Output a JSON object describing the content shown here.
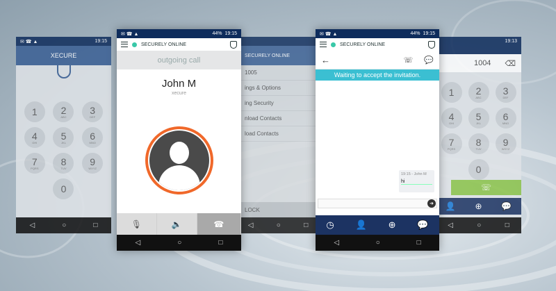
{
  "colors": {
    "navy": "#0e2c5c",
    "orange": "#f0682a",
    "teal": "#3bbfd2",
    "green": "#39c8a8"
  },
  "status": {
    "time_left": "19:15",
    "time_right": "19:13",
    "battery": "44%"
  },
  "phone_a": {
    "title": "XECURE",
    "keys": [
      {
        "d": "1",
        "l": ""
      },
      {
        "d": "2",
        "l": "ABC"
      },
      {
        "d": "3",
        "l": "DEF"
      },
      {
        "d": "4",
        "l": "GHI"
      },
      {
        "d": "5",
        "l": "JKL"
      },
      {
        "d": "6",
        "l": "MNO"
      },
      {
        "d": "7",
        "l": "PQRS"
      },
      {
        "d": "8",
        "l": "TUV"
      },
      {
        "d": "9",
        "l": "WXYZ"
      },
      {
        "d": "",
        "l": ""
      },
      {
        "d": "0",
        "l": ""
      },
      {
        "d": "",
        "l": ""
      }
    ]
  },
  "phone_b": {
    "status_text": "SECURELY ONLINE",
    "header": "outgoing call",
    "callee_name": "John M",
    "callee_sub": "xecure"
  },
  "phone_c": {
    "top_text": "SECURELY ONLINE",
    "number": "1005",
    "menu": [
      "ings & Options",
      "ing Security",
      "nload Contacts",
      "load Contacts"
    ],
    "lock": "LOCK"
  },
  "phone_d": {
    "status_text": "SECURELY ONLINE",
    "waiting": "Waiting to accept the invitation.",
    "bubble_meta": "19:15 - John M",
    "bubble_msg": "hi"
  },
  "phone_e": {
    "number": "1004"
  }
}
